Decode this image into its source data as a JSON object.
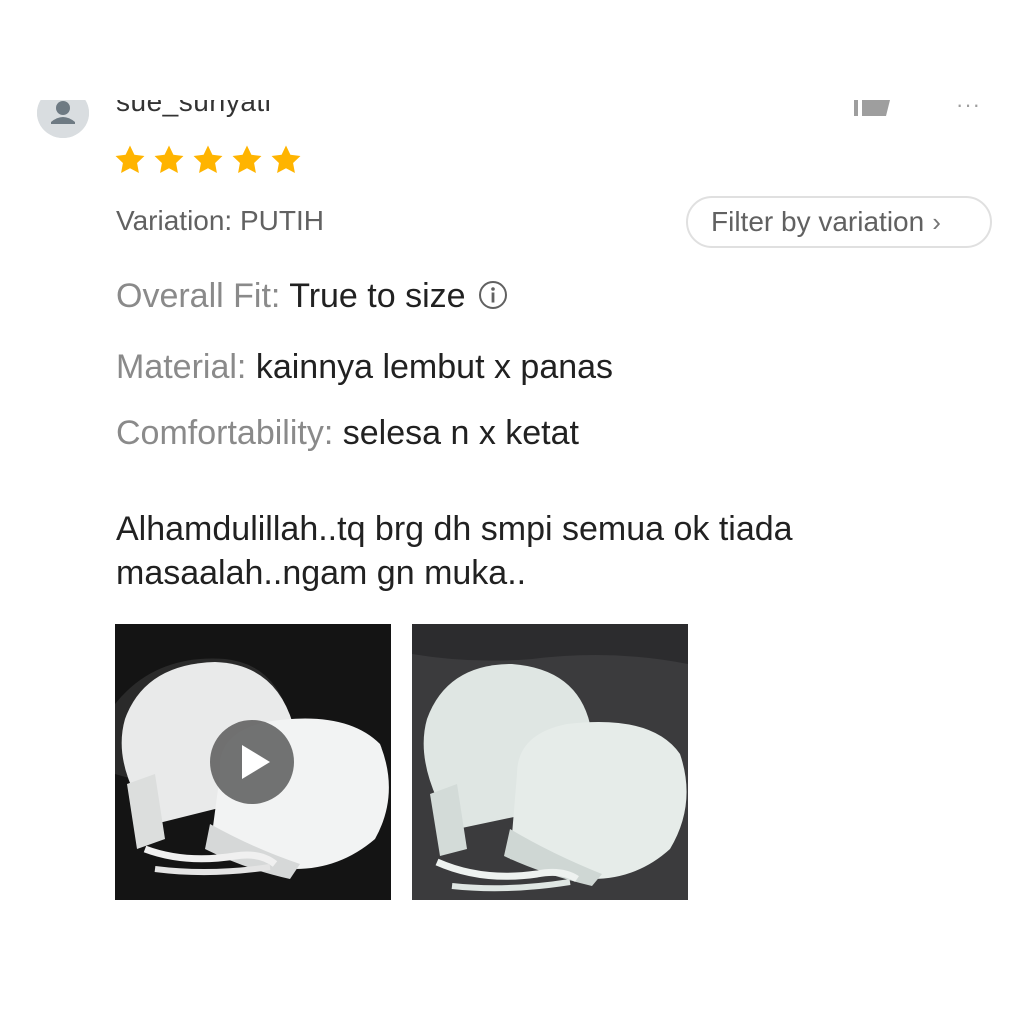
{
  "review": {
    "username": "sue_suriyati",
    "rating": 5,
    "rating_max": 5,
    "variation_label": "Variation: PUTIH",
    "filter_button_label": "Filter by variation",
    "attributes": [
      {
        "key": "Overall Fit: ",
        "value": "True to size"
      },
      {
        "key": "Material: ",
        "value": "kainnya lembut x panas"
      },
      {
        "key": "Comfortability: ",
        "value": "selesa n x ketat"
      }
    ],
    "text_line1": "Alhamdulillah..tq brg dh smpi semua ok tiada",
    "text_line2": "masaalah..ngam gn muka..",
    "media": [
      {
        "type": "video",
        "icon": "play-icon"
      },
      {
        "type": "image"
      }
    ]
  },
  "icons": {
    "avatar": "user-avatar-icon",
    "like": "thumbs-up-icon",
    "more": "more-options-icon",
    "star": "star-icon",
    "info": "info-icon",
    "chevron": "chevron-right-icon"
  },
  "colors": {
    "star": "#FFB400",
    "text_primary": "#212121",
    "text_secondary": "#8a8a8a",
    "button_border": "#e0e0e0"
  }
}
